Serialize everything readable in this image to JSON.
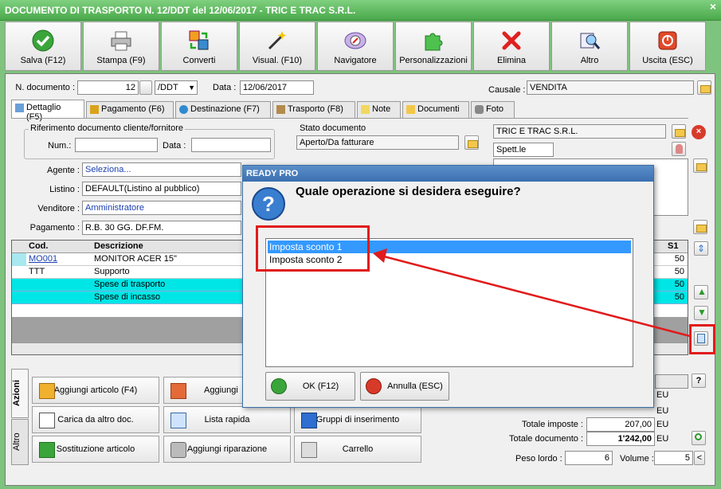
{
  "window": {
    "title": "DOCUMENTO DI TRASPORTO N. 12/DDT del 12/06/2017 - TRIC E TRAC S.R.L.",
    "close": "×"
  },
  "toolbar": [
    {
      "label": "Salva (F12)",
      "icon": "checkmark-icon"
    },
    {
      "label": "Stampa (F9)",
      "icon": "printer-icon"
    },
    {
      "label": "Converti",
      "icon": "convert-icon"
    },
    {
      "label": "Visual. (F10)",
      "icon": "magic-wand-icon"
    },
    {
      "label": "Navigatore",
      "icon": "compass-icon"
    },
    {
      "label": "Personalizzazioni",
      "icon": "puzzle-icon"
    },
    {
      "label": "Elimina",
      "icon": "delete-icon"
    },
    {
      "label": "Altro",
      "icon": "search-icon"
    },
    {
      "label": "Uscita (ESC)",
      "icon": "power-icon"
    }
  ],
  "header": {
    "ndoc_label": "N. documento :",
    "ndoc_value": "12",
    "ndoc_series": "/DDT",
    "date_label": "Data :",
    "date_value": "12/06/2017",
    "causale_label": "Causale :",
    "causale_value": "VENDITA"
  },
  "tabs": [
    {
      "label": "Dettaglio (F5)"
    },
    {
      "label": "Pagamento (F6)"
    },
    {
      "label": "Destinazione (F7)"
    },
    {
      "label": "Trasporto (F8)"
    },
    {
      "label": "Note"
    },
    {
      "label": "Documenti"
    },
    {
      "label": "Foto"
    }
  ],
  "rif": {
    "title": "Riferimento documento cliente/fornitore",
    "num_label": "Num.:",
    "data_label": "Data :"
  },
  "stato": {
    "title": "Stato documento",
    "value": "Aperto/Da fatturare"
  },
  "cliente": {
    "name": "TRIC E TRAC S.R.L.",
    "salutation": "Spett.le"
  },
  "fields": {
    "agente_label": "Agente :",
    "agente_value": "Seleziona...",
    "listino_label": "Listino :",
    "listino_value": "DEFAULT(Listino al pubblico)",
    "venditore_label": "Venditore :",
    "venditore_value": "Amministratore",
    "pagamento_label": "Pagamento :",
    "pagamento_value": "R.B. 30 GG. DF.FM."
  },
  "grid": {
    "headers": {
      "cod": "Cod.",
      "desc": "Descrizione",
      "s1": "S1"
    },
    "rows": [
      {
        "cod": "MO001",
        "desc": "MONITOR ACER 15\"",
        "s1": "50"
      },
      {
        "cod": "TTT",
        "desc": "Supporto",
        "s1": "50"
      },
      {
        "cod": "",
        "desc": "Spese di trasporto",
        "s1": "50"
      },
      {
        "cod": "",
        "desc": "Spese di incasso",
        "s1": "50"
      }
    ]
  },
  "actions": {
    "side_tabs": [
      "Azioni",
      "Altro"
    ],
    "buttons": [
      {
        "label": "Aggiungi articolo (F4)"
      },
      {
        "label": "Aggiungi a"
      },
      {
        "label": "Carica da altro doc."
      },
      {
        "label": "Lista rapida"
      },
      {
        "label": "Gruppi di inserimento"
      },
      {
        "label": "Sostituzione articolo"
      },
      {
        "label": "Aggiungi riparazione"
      },
      {
        "label": "Carrello"
      }
    ]
  },
  "totals": {
    "q_btn": "?",
    "currency": "EU",
    "imposte_label": "Totale imposte :",
    "imposte_value": "207,00",
    "documento_label": "Totale documento :",
    "documento_value": "1'242,00",
    "peso_label": "Peso lordo :",
    "peso_value": "6",
    "volume_label": "Volume :",
    "volume_value": "5",
    "lt": "<"
  },
  "dialog": {
    "title": "READY PRO",
    "question": "Quale operazione si desidera eseguire?",
    "options": [
      "Imposta sconto 1",
      "Imposta sconto 2"
    ],
    "ok_label": "OK (F12)",
    "cancel_label": "Annulla (ESC)"
  }
}
